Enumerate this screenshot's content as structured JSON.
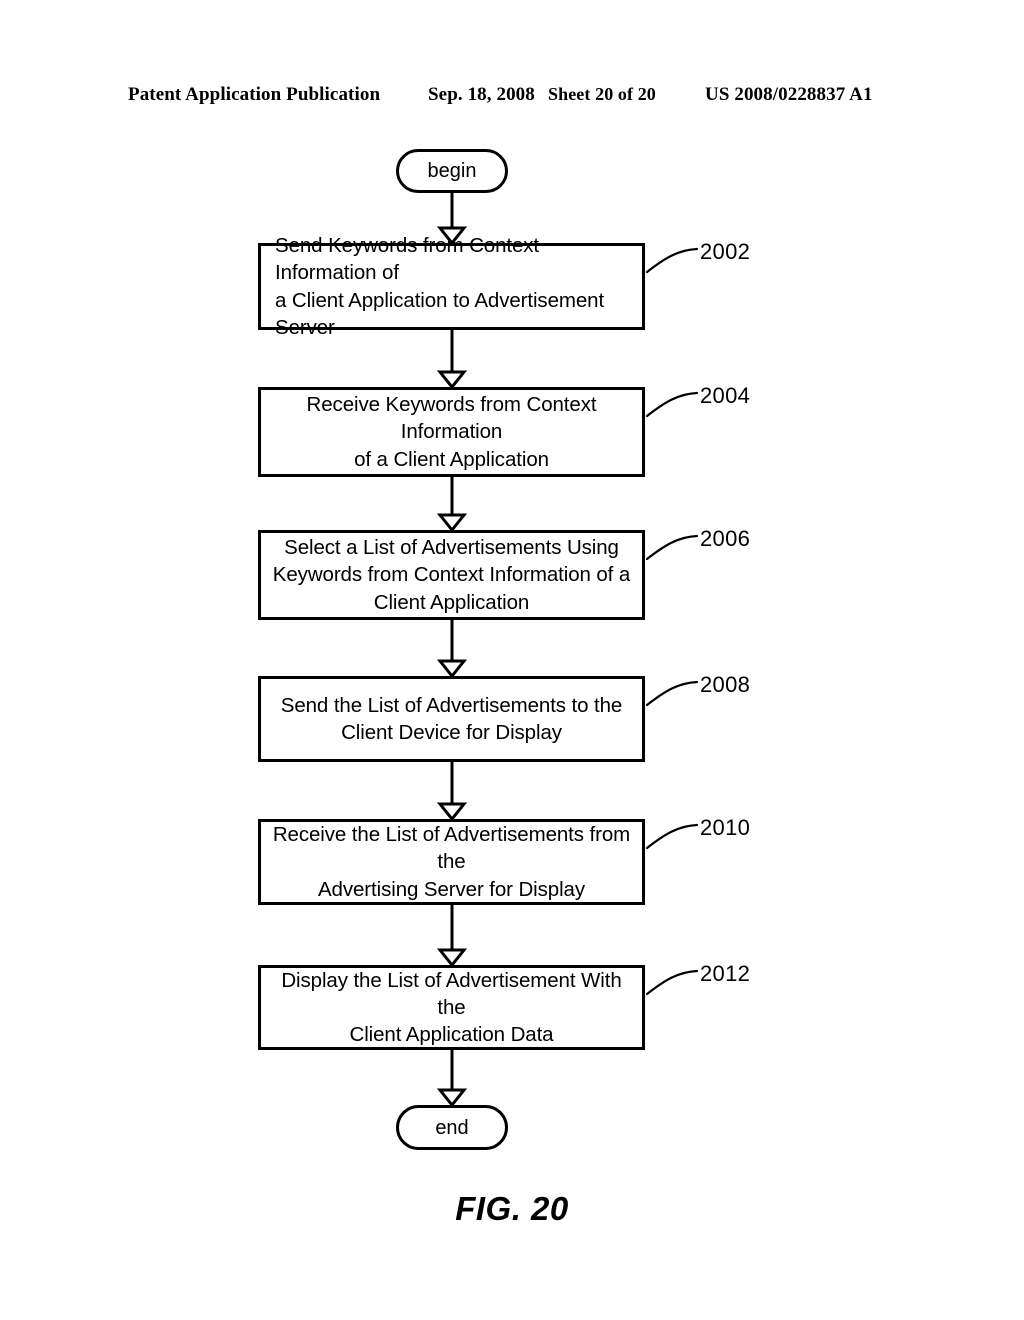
{
  "header": {
    "publication": "Patent Application Publication",
    "date": "Sep. 18, 2008",
    "sheet": "Sheet 20 of 20",
    "patent_number": "US 2008/0228837 A1"
  },
  "figure": {
    "caption": "FIG. 20",
    "start_label": "begin",
    "end_label": "end"
  },
  "flow": {
    "steps": [
      {
        "ref": "2002",
        "text": "Send Keywords from Context Information of\na Client Application to Advertisement Server"
      },
      {
        "ref": "2004",
        "text": "Receive Keywords from Context Information\nof a Client Application"
      },
      {
        "ref": "2006",
        "text": "Select a List of Advertisements Using\nKeywords from Context Information of a\nClient Application"
      },
      {
        "ref": "2008",
        "text": "Send the List of Advertisements to the\nClient Device for Display"
      },
      {
        "ref": "2010",
        "text": "Receive the List of Advertisements from the\nAdvertising Server for Display"
      },
      {
        "ref": "2012",
        "text": "Display the List of Advertisement With the\nClient Application Data"
      }
    ]
  },
  "colors": {
    "ink": "#000000",
    "paper": "#ffffff"
  }
}
